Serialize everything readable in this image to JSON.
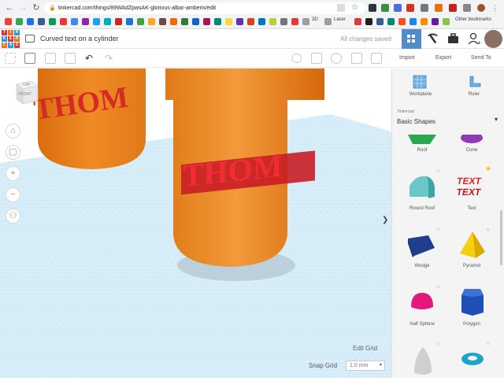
{
  "browser": {
    "url": "tinkercad.com/things/89WAdZpwsAK-glorious-albar-amberis/edit",
    "bookmarks": {
      "folder_3d": "3D",
      "folder_laser": "Laser",
      "other": "Other bookmarks"
    }
  },
  "header": {
    "title": "Curved text on a cylinder",
    "status": "All changes saved",
    "logo_letters": [
      "TIN",
      "KER",
      "CAD"
    ]
  },
  "toolbar": {
    "import_label": "Import",
    "export_label": "Export",
    "sendto_label": "Send To"
  },
  "viewcube": {
    "top": "TOP",
    "front": "FRONT"
  },
  "scene": {
    "text_left": "THOM",
    "text_right": "THOM"
  },
  "sidebar": {
    "workplane_label": "Workplane",
    "ruler_label": "Ruler",
    "library_source": "Tinkercad",
    "library_name": "Basic Shapes",
    "shapes": [
      {
        "label": "Roof"
      },
      {
        "label": "Cone"
      },
      {
        "label": "Round Roof"
      },
      {
        "label": "Text"
      },
      {
        "label": "Wedge"
      },
      {
        "label": "Pyramid"
      },
      {
        "label": "Half Sphere"
      },
      {
        "label": "Polygon"
      }
    ]
  },
  "grid": {
    "edit_label": "Edit Grid",
    "snap_label": "Snap Grid",
    "snap_value": "1.0 mm"
  },
  "colors": {
    "cylinder": "#f08a24",
    "text_red": "#e8232c",
    "workplane": "#cfe9f7",
    "accent_blue": "#4f8cc9"
  }
}
